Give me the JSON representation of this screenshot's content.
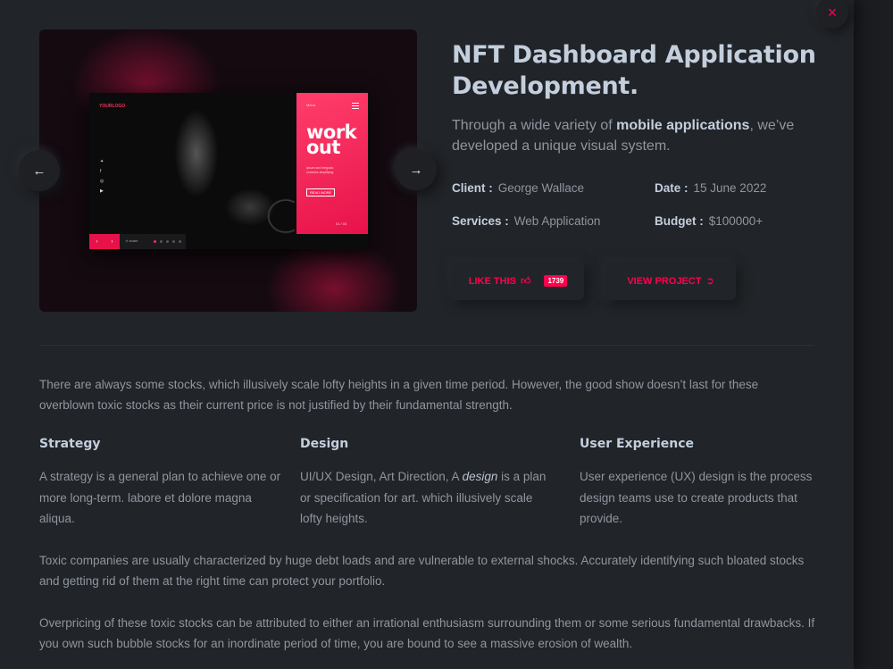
{
  "close_icon": "×",
  "hero": {
    "logo": "YOURLOGO",
    "menu_label": "Menu",
    "headline": "work out",
    "subtext": "Ipsum sed irregular, conscius amplifying",
    "more_button": "READ MORE",
    "pager": "01 / 03",
    "share_label": "share",
    "social_icons": [
      "twitter-icon",
      "facebook-icon",
      "instagram-icon",
      "youtube-icon"
    ],
    "arrows": {
      "prev": "‹",
      "next": "›"
    }
  },
  "nav": {
    "prev_icon": "←",
    "next_icon": "→"
  },
  "project": {
    "title": "NFT Dashboard Application Development.",
    "lead_before": "Through a wide variety of ",
    "lead_bold": "mobile applications",
    "lead_after": ", we’ve developed a unique visual system.",
    "meta": {
      "client_label": "Client :",
      "client_value": "George Wallace",
      "date_label": "Date :",
      "date_value": "15 June 2022",
      "services_label": "Services :",
      "services_value": "Web Application",
      "budget_label": "Budget :",
      "budget_value": "$100000+"
    },
    "like_label": "LIKE THIS",
    "like_icon": "thumbs-up-icon",
    "like_count": "1739",
    "view_label": "VIEW PROJECT",
    "view_icon": "arrow-circle-right-icon"
  },
  "body": {
    "intro": "There are always some stocks, which illusively scale lofty heights in a given time period. However, the good show doesn’t last for these overblown toxic stocks as their current price is not justified by their fundamental strength.",
    "columns": [
      {
        "heading": "Strategy",
        "text": "A strategy is a general plan to achieve one or more long-term. labore et dolore magna aliqua."
      },
      {
        "heading": "Design",
        "text_before": "UI/UX Design, Art Direction, A ",
        "text_em": "design",
        "text_after": " is a plan or specification for art. which illusively scale lofty heights."
      },
      {
        "heading": "User Experience",
        "text": "User experience (UX) design is the process design teams use to create products that provide."
      }
    ],
    "para2": "Toxic companies are usually characterized by huge debt loads and are vulnerable to external shocks. Accurately identifying such bloated stocks and getting rid of them at the right time can protect your portfolio.",
    "para3": "Overpricing of these toxic stocks can be attributed to either an irrational enthusiasm surrounding them or some serious fundamental drawbacks. If you own such bubble stocks for an inordinate period of time, you are bound to see a massive erosion of wealth."
  },
  "colors": {
    "accent": "#ff014f",
    "background": "#212428",
    "heading": "#c4cfde",
    "text": "#8f96a0"
  }
}
